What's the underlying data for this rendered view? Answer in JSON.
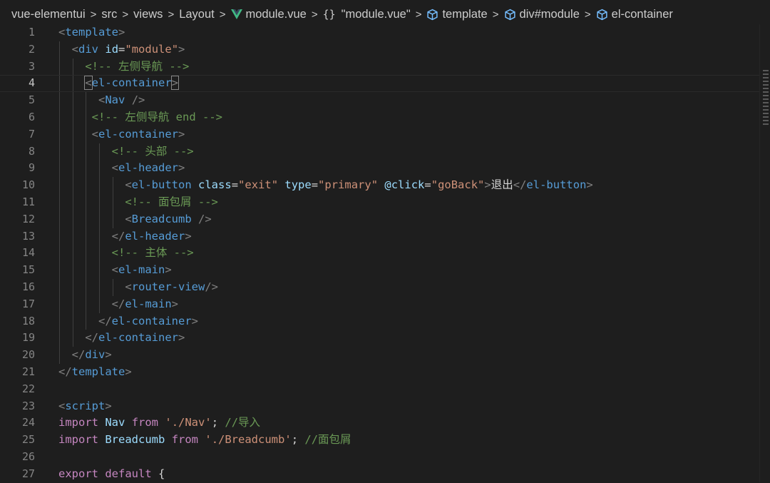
{
  "breadcrumb": {
    "items": [
      {
        "label": "vue-elementui",
        "icon": ""
      },
      {
        "label": "src",
        "icon": ""
      },
      {
        "label": "views",
        "icon": ""
      },
      {
        "label": "Layout",
        "icon": ""
      },
      {
        "label": "module.vue",
        "icon": "vue-icon"
      },
      {
        "label": "\"module.vue\"",
        "icon": "braces-icon"
      },
      {
        "label": "template",
        "icon": "cube-icon"
      },
      {
        "label": "div#module",
        "icon": "cube-icon"
      },
      {
        "label": "el-container",
        "icon": "cube-icon"
      }
    ],
    "separator": ">",
    "braces_glyph": "{}"
  },
  "editor": {
    "current_line": 4,
    "lines": [
      {
        "n": "1",
        "tokens": [
          [
            "t-tag",
            "<"
          ],
          [
            "t-name",
            "template"
          ],
          [
            "t-tag",
            ">"
          ]
        ]
      },
      {
        "n": "2",
        "tokens": [
          [
            "t-txt",
            "  "
          ],
          [
            "t-tag",
            "<"
          ],
          [
            "t-name",
            "div"
          ],
          [
            "t-txt",
            " "
          ],
          [
            "t-attr",
            "id"
          ],
          [
            "t-punc",
            "="
          ],
          [
            "t-str",
            "\"module\""
          ],
          [
            "t-tag",
            ">"
          ]
        ]
      },
      {
        "n": "3",
        "tokens": [
          [
            "t-txt",
            "    "
          ],
          [
            "t-cmt",
            "<!-- 左侧导航 -->"
          ]
        ]
      },
      {
        "n": "4",
        "tokens": [
          [
            "t-txt",
            "    "
          ],
          [
            "t-tag",
            "<"
          ],
          [
            "t-name",
            "el-container"
          ],
          [
            "t-tag",
            ">"
          ]
        ]
      },
      {
        "n": "5",
        "tokens": [
          [
            "t-txt",
            "      "
          ],
          [
            "t-tag",
            "<"
          ],
          [
            "t-name",
            "Nav"
          ],
          [
            "t-txt",
            " "
          ],
          [
            "t-tag",
            "/>"
          ]
        ]
      },
      {
        "n": "6",
        "tokens": [
          [
            "t-txt",
            "     "
          ],
          [
            "t-cmt",
            "<!-- 左侧导航 end -->"
          ]
        ]
      },
      {
        "n": "7",
        "tokens": [
          [
            "t-txt",
            "     "
          ],
          [
            "t-tag",
            "<"
          ],
          [
            "t-name",
            "el-container"
          ],
          [
            "t-tag",
            ">"
          ]
        ]
      },
      {
        "n": "8",
        "tokens": [
          [
            "t-txt",
            "        "
          ],
          [
            "t-cmt",
            "<!-- 头部 -->"
          ]
        ]
      },
      {
        "n": "9",
        "tokens": [
          [
            "t-txt",
            "        "
          ],
          [
            "t-tag",
            "<"
          ],
          [
            "t-name",
            "el-header"
          ],
          [
            "t-tag",
            ">"
          ]
        ]
      },
      {
        "n": "10",
        "tokens": [
          [
            "t-txt",
            "          "
          ],
          [
            "t-tag",
            "<"
          ],
          [
            "t-name",
            "el-button"
          ],
          [
            "t-txt",
            " "
          ],
          [
            "t-attr",
            "class"
          ],
          [
            "t-punc",
            "="
          ],
          [
            "t-str",
            "\"exit\""
          ],
          [
            "t-txt",
            " "
          ],
          [
            "t-attr",
            "type"
          ],
          [
            "t-punc",
            "="
          ],
          [
            "t-str",
            "\"primary\""
          ],
          [
            "t-txt",
            " "
          ],
          [
            "t-attr",
            "@click"
          ],
          [
            "t-punc",
            "="
          ],
          [
            "t-str",
            "\"goBack\""
          ],
          [
            "t-tag",
            ">"
          ],
          [
            "t-txt",
            "退出"
          ],
          [
            "t-tag",
            "</"
          ],
          [
            "t-name",
            "el-button"
          ],
          [
            "t-tag",
            ">"
          ]
        ]
      },
      {
        "n": "11",
        "tokens": [
          [
            "t-txt",
            "          "
          ],
          [
            "t-cmt",
            "<!-- 面包屑 -->"
          ]
        ]
      },
      {
        "n": "12",
        "tokens": [
          [
            "t-txt",
            "          "
          ],
          [
            "t-tag",
            "<"
          ],
          [
            "t-name",
            "Breadcumb"
          ],
          [
            "t-txt",
            " "
          ],
          [
            "t-tag",
            "/>"
          ]
        ]
      },
      {
        "n": "13",
        "tokens": [
          [
            "t-txt",
            "        "
          ],
          [
            "t-tag",
            "</"
          ],
          [
            "t-name",
            "el-header"
          ],
          [
            "t-tag",
            ">"
          ]
        ]
      },
      {
        "n": "14",
        "tokens": [
          [
            "t-txt",
            "        "
          ],
          [
            "t-cmt",
            "<!-- 主体 -->"
          ]
        ]
      },
      {
        "n": "15",
        "tokens": [
          [
            "t-txt",
            "        "
          ],
          [
            "t-tag",
            "<"
          ],
          [
            "t-name",
            "el-main"
          ],
          [
            "t-tag",
            ">"
          ]
        ]
      },
      {
        "n": "16",
        "tokens": [
          [
            "t-txt",
            "          "
          ],
          [
            "t-tag",
            "<"
          ],
          [
            "t-name",
            "router-view"
          ],
          [
            "t-tag",
            "/>"
          ]
        ]
      },
      {
        "n": "17",
        "tokens": [
          [
            "t-txt",
            "        "
          ],
          [
            "t-tag",
            "</"
          ],
          [
            "t-name",
            "el-main"
          ],
          [
            "t-tag",
            ">"
          ]
        ]
      },
      {
        "n": "18",
        "tokens": [
          [
            "t-txt",
            "      "
          ],
          [
            "t-tag",
            "</"
          ],
          [
            "t-name",
            "el-container"
          ],
          [
            "t-tag",
            ">"
          ]
        ]
      },
      {
        "n": "19",
        "tokens": [
          [
            "t-txt",
            "    "
          ],
          [
            "t-tag",
            "</"
          ],
          [
            "t-name",
            "el-container"
          ],
          [
            "t-tag",
            ">"
          ]
        ]
      },
      {
        "n": "20",
        "tokens": [
          [
            "t-txt",
            "  "
          ],
          [
            "t-tag",
            "</"
          ],
          [
            "t-name",
            "div"
          ],
          [
            "t-tag",
            ">"
          ]
        ]
      },
      {
        "n": "21",
        "tokens": [
          [
            "t-tag",
            "</"
          ],
          [
            "t-name",
            "template"
          ],
          [
            "t-tag",
            ">"
          ]
        ]
      },
      {
        "n": "22",
        "tokens": []
      },
      {
        "n": "23",
        "tokens": [
          [
            "t-tag",
            "<"
          ],
          [
            "t-name",
            "script"
          ],
          [
            "t-tag",
            ">"
          ]
        ]
      },
      {
        "n": "24",
        "tokens": [
          [
            "t-kw",
            "import"
          ],
          [
            "t-txt",
            " "
          ],
          [
            "t-var",
            "Nav"
          ],
          [
            "t-txt",
            " "
          ],
          [
            "t-kw",
            "from"
          ],
          [
            "t-txt",
            " "
          ],
          [
            "t-str",
            "'./Nav'"
          ],
          [
            "t-punc",
            ";"
          ],
          [
            "t-txt",
            " "
          ],
          [
            "t-cmt",
            "//导入"
          ]
        ]
      },
      {
        "n": "25",
        "tokens": [
          [
            "t-kw",
            "import"
          ],
          [
            "t-txt",
            " "
          ],
          [
            "t-var",
            "Breadcumb"
          ],
          [
            "t-txt",
            " "
          ],
          [
            "t-kw",
            "from"
          ],
          [
            "t-txt",
            " "
          ],
          [
            "t-str",
            "'./Breadcumb'"
          ],
          [
            "t-punc",
            ";"
          ],
          [
            "t-txt",
            " "
          ],
          [
            "t-cmt",
            "//面包屑"
          ]
        ]
      },
      {
        "n": "26",
        "tokens": []
      },
      {
        "n": "27",
        "tokens": [
          [
            "t-kw",
            "export"
          ],
          [
            "t-txt",
            " "
          ],
          [
            "t-kw",
            "default"
          ],
          [
            "t-txt",
            " "
          ],
          [
            "t-punc",
            "{"
          ]
        ]
      }
    ]
  }
}
